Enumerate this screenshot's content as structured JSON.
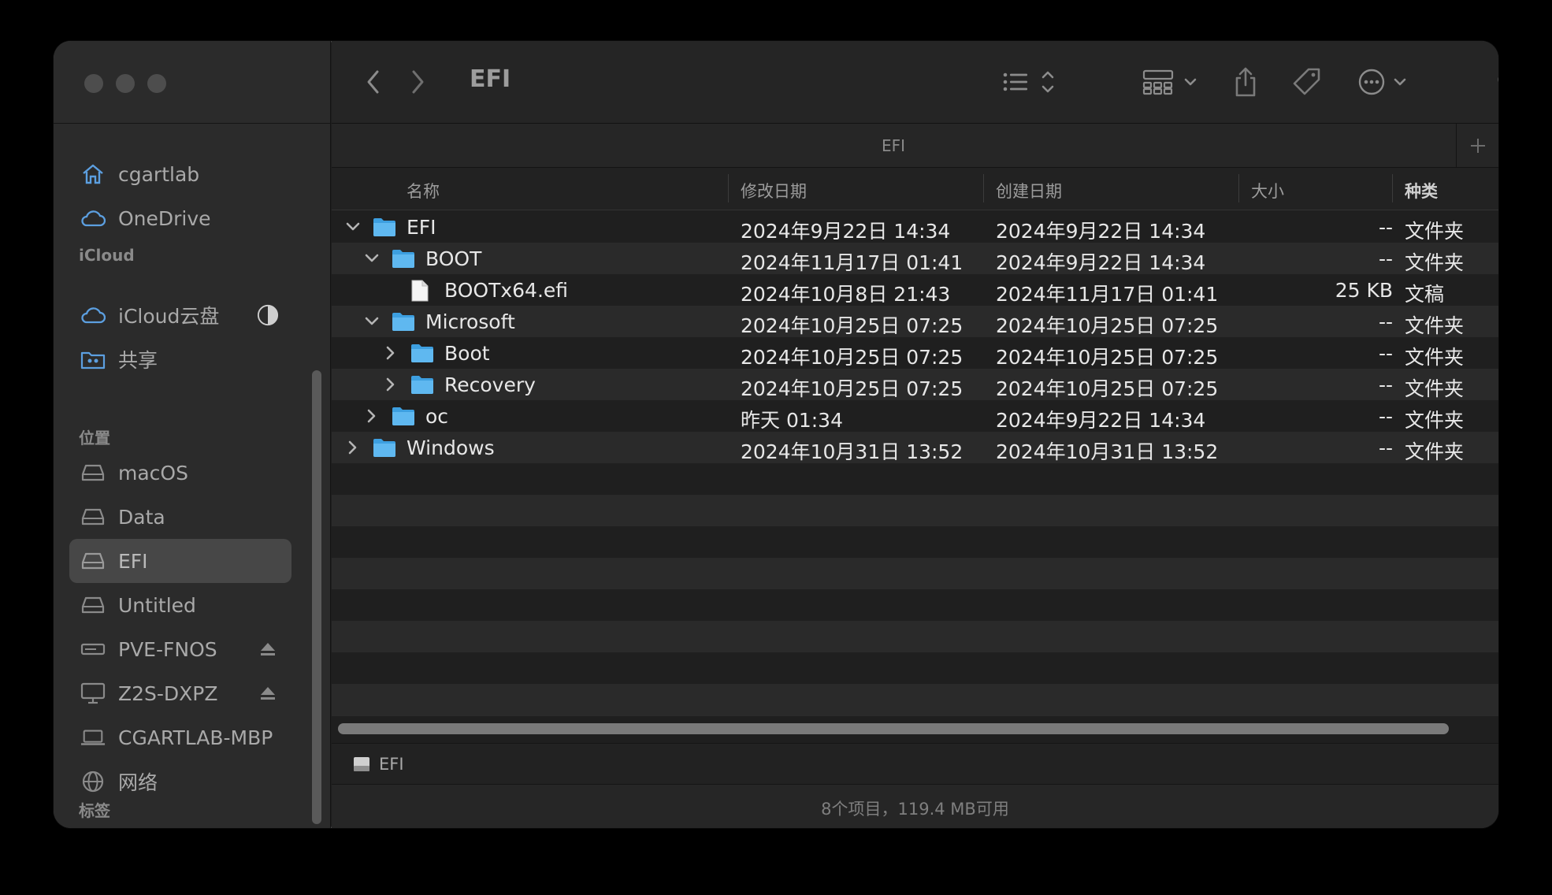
{
  "sidebar": {
    "favorites": [
      {
        "label": "cgartlab",
        "icon": "home-icon"
      },
      {
        "label": "OneDrive",
        "icon": "cloud-icon"
      }
    ],
    "icloud_header": "iCloud",
    "icloud": [
      {
        "label": "iCloud云盘",
        "icon": "cloud-icon"
      },
      {
        "label": "共享",
        "icon": "shared-folder-icon"
      }
    ],
    "locations_header": "位置",
    "locations": [
      {
        "label": "macOS",
        "icon": "disk-icon"
      },
      {
        "label": "Data",
        "icon": "disk-icon"
      },
      {
        "label": "EFI",
        "icon": "disk-icon",
        "selected": true
      },
      {
        "label": "Untitled",
        "icon": "disk-icon"
      },
      {
        "label": "PVE-FNOS",
        "icon": "server-icon"
      },
      {
        "label": "Z2S-DXPZ",
        "icon": "display-icon"
      },
      {
        "label": "CGARTLAB-MBP",
        "icon": "laptop-icon"
      },
      {
        "label": "网络",
        "icon": "network-icon"
      }
    ],
    "tags_header": "标签"
  },
  "toolbar": {
    "title": "EFI"
  },
  "tab": {
    "label": "EFI"
  },
  "columns": {
    "name": "名称",
    "modified": "修改日期",
    "created": "创建日期",
    "size": "大小",
    "kind": "种类"
  },
  "files": [
    {
      "name": "EFI",
      "level": 0,
      "chevron": "down",
      "type": "folder",
      "modified": "2024年9月22日 14:34",
      "created": "2024年9月22日 14:34",
      "size": "--",
      "kind": "文件夹"
    },
    {
      "name": "BOOT",
      "level": 1,
      "chevron": "down",
      "type": "folder",
      "modified": "2024年11月17日 01:41",
      "created": "2024年9月22日 14:34",
      "size": "--",
      "kind": "文件夹"
    },
    {
      "name": "BOOTx64.efi",
      "level": 2,
      "chevron": "none",
      "type": "file",
      "modified": "2024年10月8日 21:43",
      "created": "2024年11月17日 01:41",
      "size": "25 KB",
      "kind": "文稿"
    },
    {
      "name": "Microsoft",
      "level": 1,
      "chevron": "down",
      "type": "folder",
      "modified": "2024年10月25日 07:25",
      "created": "2024年10月25日 07:25",
      "size": "--",
      "kind": "文件夹"
    },
    {
      "name": "Boot",
      "level": 2,
      "chevron": "right",
      "type": "folder",
      "modified": "2024年10月25日 07:25",
      "created": "2024年10月25日 07:25",
      "size": "--",
      "kind": "文件夹"
    },
    {
      "name": "Recovery",
      "level": 2,
      "chevron": "right",
      "type": "folder",
      "modified": "2024年10月25日 07:25",
      "created": "2024年10月25日 07:25",
      "size": "--",
      "kind": "文件夹"
    },
    {
      "name": "oc",
      "level": 1,
      "chevron": "right",
      "type": "folder",
      "modified": "昨天 01:34",
      "created": "2024年9月22日 14:34",
      "size": "--",
      "kind": "文件夹"
    },
    {
      "name": "Windows",
      "level": 0,
      "chevron": "right",
      "type": "folder",
      "modified": "2024年10月31日 13:52",
      "created": "2024年10月31日 13:52",
      "size": "--",
      "kind": "文件夹"
    }
  ],
  "pathbar": {
    "label": "EFI"
  },
  "status": {
    "text": "8个项目，119.4 MB可用"
  },
  "colors": {
    "folder": "#5fb8f0",
    "folder_tab": "#3d9fe0",
    "sidebar_icon": "#5c9fe0"
  }
}
